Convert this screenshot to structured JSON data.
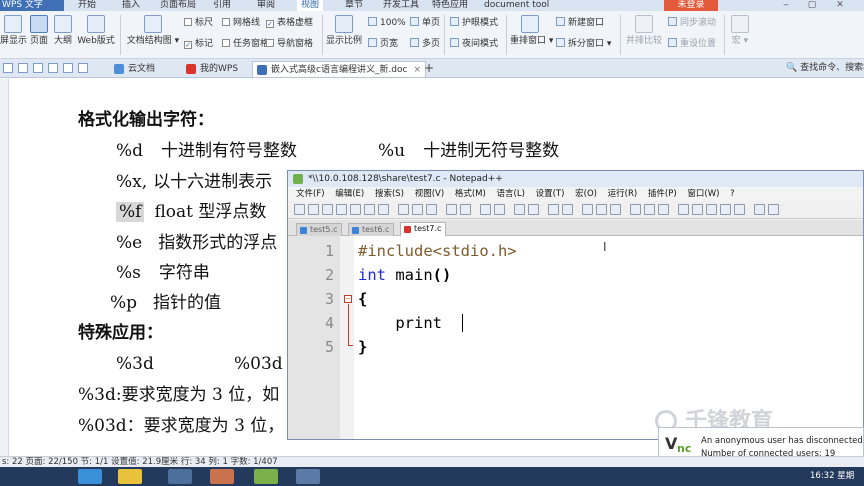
{
  "wps": {
    "app_name": "WPS 文字",
    "tabs": [
      "开始",
      "插入",
      "页面布局",
      "引用",
      "审阅",
      "视图",
      "章节",
      "开发工具",
      "特色应用",
      "document tool"
    ],
    "active_tab": "视图",
    "login_label": "未登录",
    "win_controls": [
      "‒",
      "▢",
      "✕"
    ],
    "brand_color": "#3f6fb5"
  },
  "ribbon": {
    "big_buttons": [
      {
        "label": "屏显示"
      },
      {
        "label": "页面"
      },
      {
        "label": "大纲"
      },
      {
        "label": "Web版式"
      },
      {
        "label": "文档结构图 ▾"
      },
      {
        "label": "显示比例"
      },
      {
        "label": "护眼模式"
      },
      {
        "label": "夜间模式"
      },
      {
        "label": "重排窗口 ▾"
      },
      {
        "label": "拆分窗口 ▾"
      },
      {
        "label": "并排比较"
      },
      {
        "label": "宏 ▾"
      }
    ],
    "checkboxes": [
      {
        "label": "标尺",
        "checked": false
      },
      {
        "label": "网格线",
        "checked": false
      },
      {
        "label": "表格虚框",
        "checked": true
      },
      {
        "label": "标记",
        "checked": true
      },
      {
        "label": "任务窗格",
        "checked": false
      },
      {
        "label": "导航窗格",
        "checked": false
      }
    ],
    "small_items": {
      "zoom": "100%",
      "single_page": "单页",
      "page_width": "页宽",
      "multi_page": "多页",
      "new_window": "新建窗口",
      "sync_scroll": "同步滚动",
      "reset_position": "重设位置"
    }
  },
  "tabbar": {
    "tabs": [
      {
        "label": "云文档",
        "color": "#4a90d9",
        "active": false
      },
      {
        "label": "我的WPS",
        "color": "#d9342b",
        "active": false
      },
      {
        "label": "嵌入式高级c语言编程讲义_新.doc",
        "color": "#3f6fb5",
        "active": true
      }
    ],
    "new_tab": "+",
    "command_search": "查找命令、搜索模"
  },
  "document": {
    "lines": [
      {
        "text": "格式化输出字符：",
        "bold": true
      },
      {
        "spec": "%d",
        "desc": "十进制有符号整数",
        "spec2": "%u",
        "desc2": "十进制无符号整数"
      },
      {
        "spec": "%x,",
        "desc": "以十六进制表示"
      },
      {
        "spec": "%f",
        "desc": "float 型浮点数",
        "highlight": true
      },
      {
        "spec": "%e",
        "desc": "指数形式的浮点"
      },
      {
        "spec": "%s",
        "desc": "字符串"
      },
      {
        "spec": "%p",
        "desc": "指针的值"
      },
      {
        "text": "特殊应用：",
        "bold": true
      },
      {
        "spec": "%3d",
        "spec2": "%03d"
      },
      {
        "text": "%3d:要求宽度为 3 位，如"
      },
      {
        "text": "%03d：要求宽度为 3 位，"
      }
    ]
  },
  "notepad": {
    "title": "*\\\\10.0.108.128\\share\\test7.c - Notepad++",
    "menu": [
      "文件(F)",
      "编辑(E)",
      "搜索(S)",
      "视图(V)",
      "格式(M)",
      "语言(L)",
      "设置(T)",
      "宏(O)",
      "运行(R)",
      "插件(P)",
      "窗口(W)",
      "?"
    ],
    "tabs": [
      {
        "label": "test5.c",
        "active": false
      },
      {
        "label": "test6.c",
        "active": false
      },
      {
        "label": "test7.c",
        "active": true
      }
    ],
    "line_numbers": [
      "1",
      "2",
      "3",
      "4",
      "5"
    ],
    "code": {
      "l1_directive": "#include",
      "l1_header": "<stdio.h>",
      "l2_keyword": "int",
      "l2_name": " main",
      "l2_parens": "()",
      "l3": "{",
      "l4": "    print",
      "l5": "}"
    },
    "keyword_color": "#1f2bd1",
    "fold_color": "#c0392b"
  },
  "vnc": {
    "logo_v": "V",
    "logo_nc": "nc",
    "message1": "An anonymous user has disconnected.",
    "message2": "Number of connected users: 19"
  },
  "watermark": "千锋教育",
  "status_bar": "s: 22   页面: 22/150   节: 1/1   设置值: 21.9厘米   行: 34   列: 1   字数: 1/407",
  "taskbar": {
    "clock": "16:32 星期"
  }
}
